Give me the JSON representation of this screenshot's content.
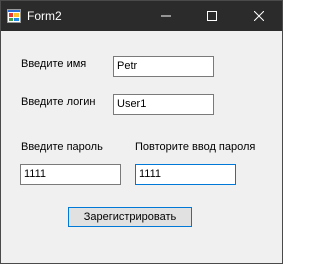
{
  "window": {
    "title": "Form2"
  },
  "form": {
    "name_label": "Введите имя",
    "name_value": "Petr",
    "login_label": "Введите логин",
    "login_value": "User1",
    "password_label": "Введите пароль",
    "password_value": "1111",
    "repeat_label": "Повторите ввод пароля",
    "repeat_value": "1111",
    "register_label": "Зарегистрировать"
  },
  "icons": {
    "app": "app-form-icon",
    "minimize": "minimize-icon",
    "maximize": "maximize-icon",
    "close": "close-icon"
  },
  "colors": {
    "titlebar": "#2b2b2b",
    "accent": "#0078d7",
    "background": "#f0f0f0"
  }
}
